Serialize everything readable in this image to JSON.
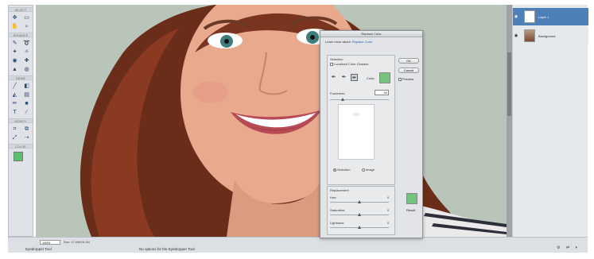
{
  "tools": {
    "sections": [
      "SELECT",
      "ENHANCE",
      "DRAW",
      "MODIFY",
      "COLOR"
    ],
    "foreground_color": "#5bbf6d",
    "background_color": "#ffffff"
  },
  "layers": {
    "items": [
      {
        "name": "Layer 1",
        "selected": true
      },
      {
        "name": "Background",
        "selected": false
      }
    ]
  },
  "status": {
    "zoom": "100%",
    "doc_info": "Doc: 17.0M/16.1M",
    "tool_name": "Eyedropper Tool",
    "tool_options": "No options for the Eyedropper Tool.",
    "icons": "⚙ ⇄ ▾"
  },
  "dialog": {
    "title": "Replace Color",
    "learn_prefix": "Learn more about:",
    "learn_link": "Replace Color",
    "selection_label": "Selection",
    "localized_label": "Localized Color Clusters",
    "color_label": "Color:",
    "fuzziness_label": "Fuzziness:",
    "fuzziness_value": "40",
    "radio_selection": "Selection",
    "radio_image": "Image",
    "ok": "OK",
    "cancel": "Cancel",
    "preview": "Preview",
    "replacement_label": "Replacement",
    "hue_label": "Hue:",
    "hue_value": "0",
    "saturation_label": "Saturation:",
    "saturation_value": "0",
    "lightness_label": "Lightness:",
    "lightness_value": "0",
    "result_label": "Result",
    "selected_color": "#72c47f",
    "result_color": "#72c47f"
  }
}
